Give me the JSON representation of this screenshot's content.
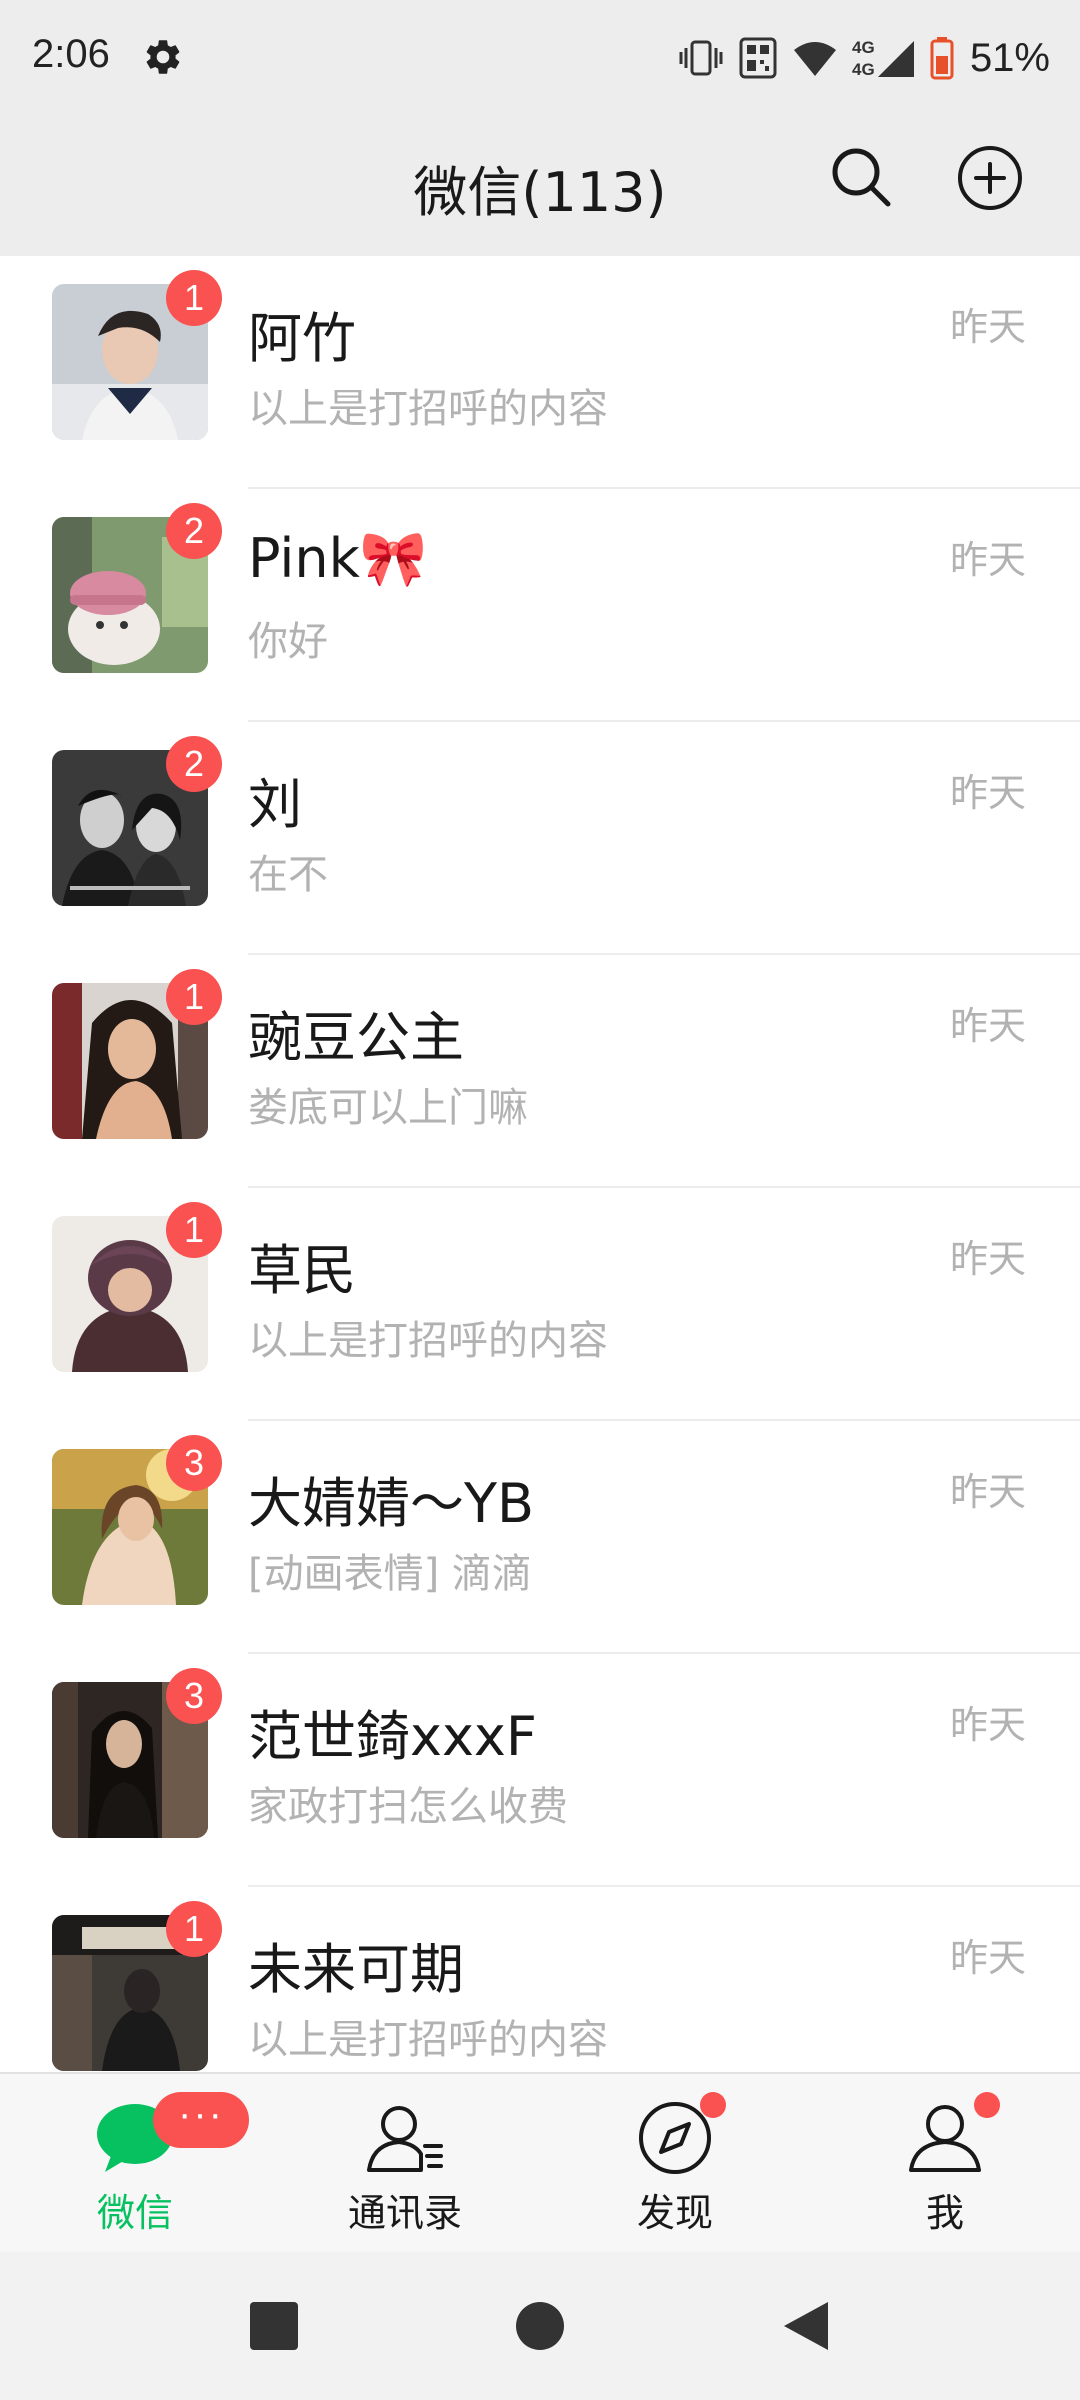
{
  "status_bar": {
    "time": "2:06",
    "battery": "51%",
    "network": "4G 4G",
    "icons": [
      "settings-icon",
      "vibrate-icon",
      "nfc-icon",
      "wifi-icon",
      "signal-icon",
      "battery-icon"
    ]
  },
  "header": {
    "title": "微信(113)",
    "icons": [
      "search-icon",
      "add-icon"
    ]
  },
  "chats": [
    {
      "name": "阿竹",
      "message": "以上是打招呼的内容",
      "time": "昨天",
      "unread": "1"
    },
    {
      "name": "Pink🎀",
      "message": "你好",
      "time": "昨天",
      "unread": "2"
    },
    {
      "name": "刘",
      "message": "在不",
      "time": "昨天",
      "unread": "2"
    },
    {
      "name": "豌豆公主",
      "message": "娄底可以上门嘛",
      "time": "昨天",
      "unread": "1"
    },
    {
      "name": "草民",
      "message": "以上是打招呼的内容",
      "time": "昨天",
      "unread": "1"
    },
    {
      "name": "大婧婧～YB",
      "message": "[动画表情] 滴滴",
      "time": "昨天",
      "unread": "3"
    },
    {
      "name": "范世錡xxxF",
      "message": "家政打扫怎么收费",
      "time": "昨天",
      "unread": "3"
    },
    {
      "name": "未来可期",
      "message": "以上是打招呼的内容",
      "time": "昨天",
      "unread": "1"
    }
  ],
  "tabs": [
    {
      "label": "微信",
      "icon": "chat-bubble-icon",
      "active": true,
      "badge": "···"
    },
    {
      "label": "通讯录",
      "icon": "contacts-icon",
      "active": false
    },
    {
      "label": "发现",
      "icon": "compass-icon",
      "active": false
    },
    {
      "label": "我",
      "icon": "person-icon",
      "active": false
    }
  ],
  "nav_bar": {
    "icons": [
      "recents-square-icon",
      "home-circle-icon",
      "back-triangle-icon"
    ]
  },
  "colors": {
    "accent_green": "#07c160",
    "badge_red": "#fa5151",
    "background": "#ededed"
  }
}
